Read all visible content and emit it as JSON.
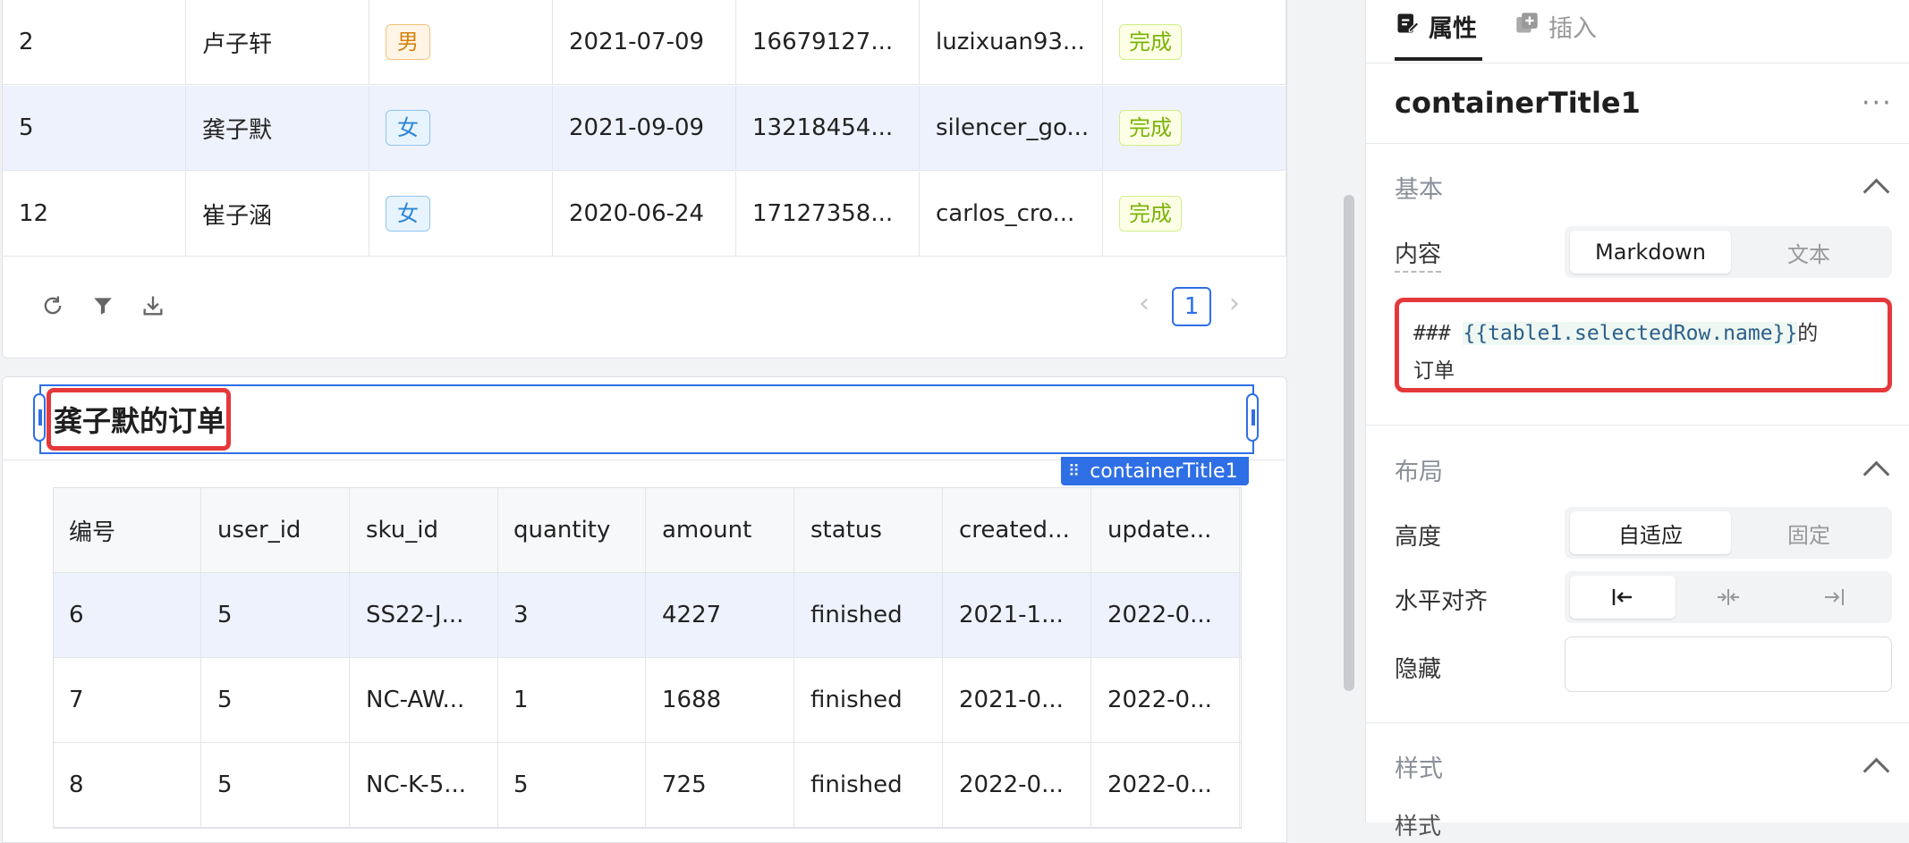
{
  "users_table": {
    "rows": [
      {
        "id": "2",
        "name": "卢子轩",
        "gender": "男",
        "gender_type": "male",
        "date": "2021-07-09",
        "phone": "16679127...",
        "email": "luzixuan93...",
        "status": "完成"
      },
      {
        "id": "5",
        "name": "龚子默",
        "gender": "女",
        "gender_type": "female",
        "date": "2021-09-09",
        "phone": "13218454...",
        "email": "silencer_go...",
        "status": "完成"
      },
      {
        "id": "12",
        "name": "崔子涵",
        "gender": "女",
        "gender_type": "female",
        "date": "2020-06-24",
        "phone": "17127358...",
        "email": "carlos_cro...",
        "status": "完成"
      }
    ],
    "toolbar": {
      "refresh_icon": "refresh-icon",
      "filter_icon": "filter-icon",
      "download_icon": "download-icon"
    },
    "pager": {
      "current_page": "1",
      "prev": "‹",
      "next": "›"
    }
  },
  "container_title": {
    "text": "龚子默的订单",
    "selection_label": "containerTitle1"
  },
  "orders_table": {
    "headers": [
      "编号",
      "user_id",
      "sku_id",
      "quantity",
      "amount",
      "status",
      "created...",
      "update..."
    ],
    "rows": [
      [
        "6",
        "5",
        "SS22-J...",
        "3",
        "4227",
        "finished",
        "2021-1...",
        "2022-0..."
      ],
      [
        "7",
        "5",
        "NC-AW...",
        "1",
        "1688",
        "finished",
        "2021-0...",
        "2022-0..."
      ],
      [
        "8",
        "5",
        "NC-K-5...",
        "5",
        "725",
        "finished",
        "2022-0...",
        "2022-0..."
      ]
    ]
  },
  "panel": {
    "tabs": [
      {
        "label": "属性",
        "icon": "edit-icon"
      },
      {
        "label": "插入",
        "icon": "add-icon"
      }
    ],
    "component_name": "containerTitle1",
    "more": "···",
    "basic": {
      "title": "基本",
      "content_label": "内容",
      "content_modes": [
        "Markdown",
        "文本"
      ],
      "code_line1_prefix": "### ",
      "code_line1_template": "{{table1.selectedRow.name}}",
      "code_line1_suffix": "的",
      "code_line2": "订单"
    },
    "layout": {
      "title": "布局",
      "height_label": "高度",
      "height_modes": [
        "自适应",
        "固定"
      ],
      "align_label": "水平对齐",
      "align_icons": [
        "align-left-icon",
        "align-center-icon",
        "align-right-icon"
      ],
      "hidden_label": "隐藏"
    },
    "style": {
      "title": "样式",
      "partial_label": "样式"
    }
  }
}
